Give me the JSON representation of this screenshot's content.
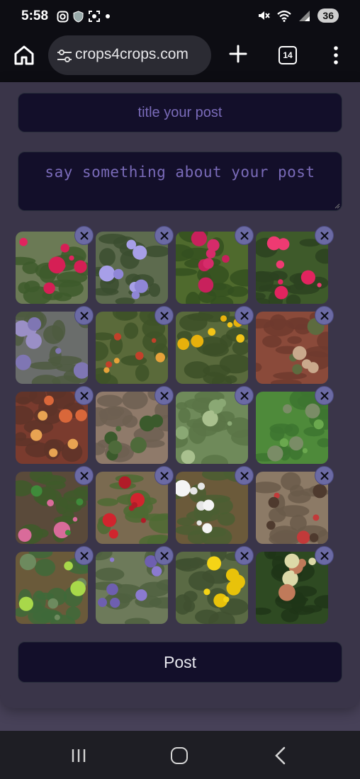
{
  "status_bar": {
    "time": "5:58",
    "battery": "36",
    "icons": [
      "instagram-icon",
      "shield-icon",
      "screenshot-icon",
      "dot-icon",
      "mute-icon",
      "wifi-icon",
      "signal-icon"
    ]
  },
  "browser": {
    "url": "crops4crops.com",
    "tab_count": "14",
    "icons": [
      "home-icon",
      "site-settings-icon",
      "plus-icon",
      "tabs-icon",
      "more-vert-icon"
    ]
  },
  "form": {
    "title_placeholder": "title your post",
    "description_placeholder": "say something about your post",
    "post_label": "Post",
    "photos": [
      {
        "name": "photo-red-rose"
      },
      {
        "name": "photo-purple-catmint"
      },
      {
        "name": "photo-pink-rose-bush"
      },
      {
        "name": "photo-red-roses-closeup"
      },
      {
        "name": "photo-lavender-bush"
      },
      {
        "name": "photo-blanket-flower"
      },
      {
        "name": "photo-yellow-pansy"
      },
      {
        "name": "photo-red-hot-poker-wall"
      },
      {
        "name": "photo-red-hot-poker-closeup"
      },
      {
        "name": "photo-mullein-rosette"
      },
      {
        "name": "photo-lambs-ear-leaves"
      },
      {
        "name": "photo-green-shrub"
      },
      {
        "name": "photo-pink-groundcover"
      },
      {
        "name": "photo-red-flower-bush"
      },
      {
        "name": "photo-white-peony"
      },
      {
        "name": "photo-red-flowers-wood"
      },
      {
        "name": "photo-spurge-plant"
      },
      {
        "name": "photo-purple-salvia"
      },
      {
        "name": "photo-yellow-yarrow"
      },
      {
        "name": "photo-pale-flower-pots"
      }
    ]
  },
  "nav_bar": {
    "icons": [
      "recent-apps-icon",
      "home-circle-icon",
      "back-icon"
    ]
  }
}
